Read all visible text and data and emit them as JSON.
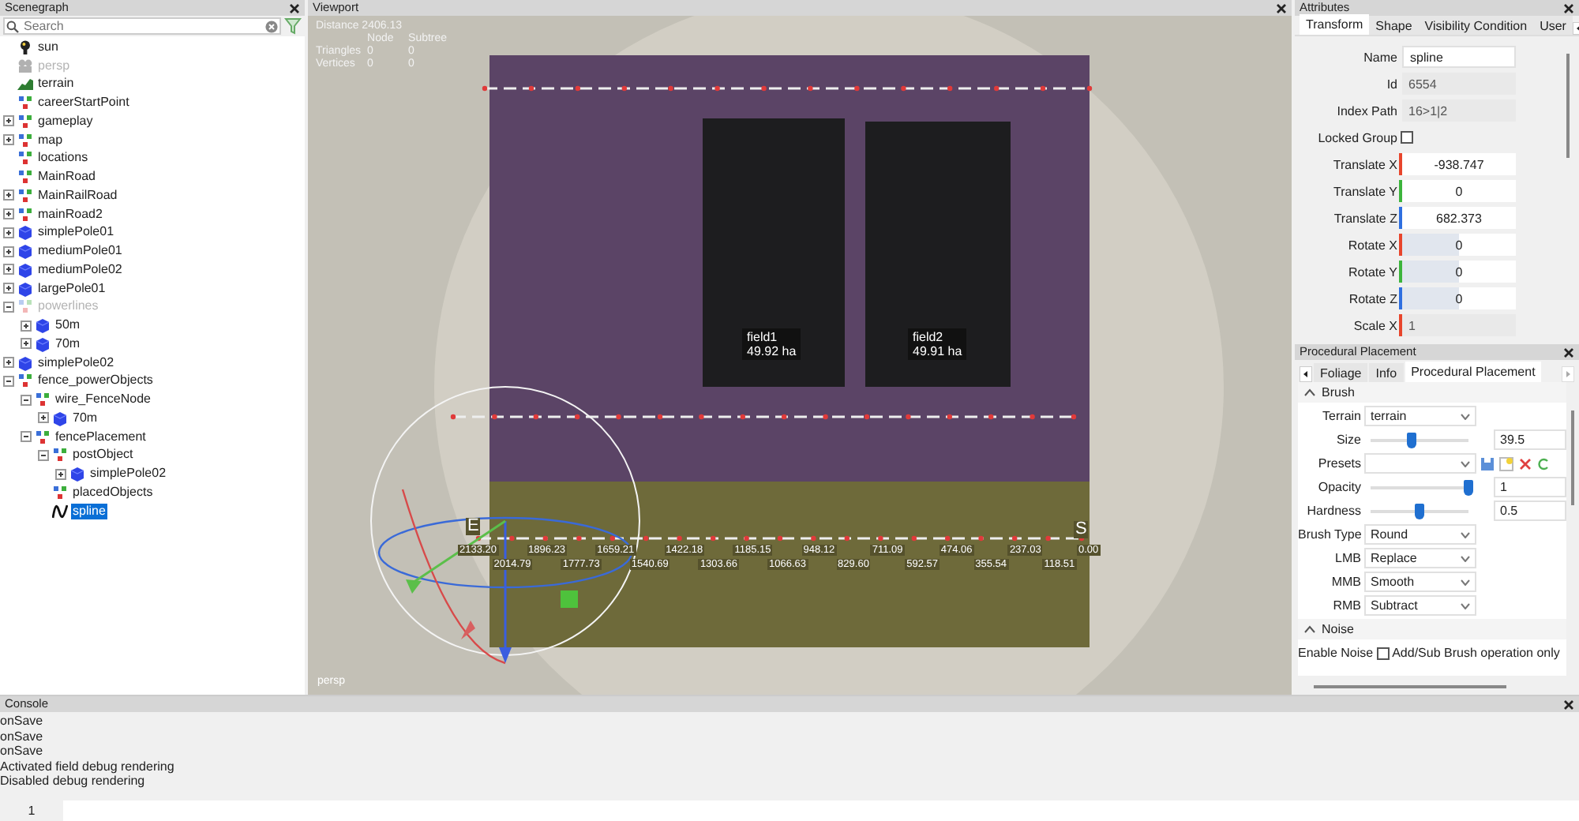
{
  "scenegraph": {
    "title": "Scenegraph",
    "search": {
      "placeholder": "Search"
    },
    "tree": [
      {
        "label": "sun",
        "kind": "light",
        "selected": false,
        "disabled": false
      },
      {
        "label": "persp",
        "kind": "camera",
        "selected": false,
        "disabled": true
      },
      {
        "label": "terrain",
        "kind": "terrain",
        "selected": false,
        "disabled": false
      },
      {
        "label": "careerStartPoint",
        "kind": "group",
        "selected": false,
        "disabled": false
      },
      {
        "label": "gameplay",
        "kind": "group",
        "expanded": false,
        "selected": false,
        "disabled": false
      },
      {
        "label": "map",
        "kind": "group",
        "expanded": false,
        "selected": false,
        "disabled": false
      },
      {
        "label": "locations",
        "kind": "group",
        "selected": false,
        "disabled": false
      },
      {
        "label": "MainRoad",
        "kind": "group",
        "selected": false,
        "disabled": false
      },
      {
        "label": "MainRailRoad",
        "kind": "group",
        "expanded": false,
        "selected": false,
        "disabled": false
      },
      {
        "label": "mainRoad2",
        "kind": "group",
        "expanded": false,
        "selected": false,
        "disabled": false
      },
      {
        "label": "simplePole01",
        "kind": "mesh",
        "expanded": false,
        "selected": false,
        "disabled": false
      },
      {
        "label": "mediumPole01",
        "kind": "mesh",
        "expanded": false,
        "selected": false,
        "disabled": false
      },
      {
        "label": "mediumPole02",
        "kind": "mesh",
        "expanded": false,
        "selected": false,
        "disabled": false
      },
      {
        "label": "largePole01",
        "kind": "mesh",
        "expanded": false,
        "selected": false,
        "disabled": false
      },
      {
        "label": "powerlines",
        "kind": "group",
        "expanded": true,
        "selected": false,
        "disabled": true,
        "children": [
          {
            "label": "50m",
            "kind": "mesh",
            "expanded": false,
            "selected": false,
            "disabled": false
          },
          {
            "label": "70m",
            "kind": "mesh",
            "expanded": false,
            "selected": false,
            "disabled": false
          }
        ]
      },
      {
        "label": "simplePole02",
        "kind": "mesh",
        "expanded": false,
        "selected": false,
        "disabled": false
      },
      {
        "label": "fence_powerObjects",
        "kind": "group",
        "expanded": true,
        "selected": false,
        "disabled": false,
        "children": [
          {
            "label": "wire_FenceNode",
            "kind": "group",
            "expanded": true,
            "selected": false,
            "disabled": false,
            "children": [
              {
                "label": "70m",
                "kind": "mesh",
                "expanded": false,
                "selected": false,
                "disabled": false
              }
            ]
          },
          {
            "label": "fencePlacement",
            "kind": "group",
            "expanded": true,
            "selected": false,
            "disabled": false,
            "children": [
              {
                "label": "postObject",
                "kind": "group",
                "expanded": true,
                "selected": false,
                "disabled": false,
                "children": [
                  {
                    "label": "simplePole02",
                    "kind": "mesh",
                    "expanded": false,
                    "selected": false,
                    "disabled": false
                  }
                ]
              },
              {
                "label": "placedObjects",
                "kind": "group",
                "selected": false,
                "disabled": false
              },
              {
                "label": "spline",
                "kind": "spline",
                "selected": true,
                "disabled": false
              }
            ]
          }
        ]
      }
    ]
  },
  "viewport": {
    "title": "Viewport",
    "distance": "Distance 2406.13",
    "stats_columns": [
      "Node",
      "Subtree"
    ],
    "stats_rows": [
      {
        "label": "Triangles",
        "node": "0",
        "subtree": "0"
      },
      {
        "label": "Vertices",
        "node": "0",
        "subtree": "0"
      }
    ],
    "fields": [
      {
        "name": "field1",
        "area": "49.92 ha"
      },
      {
        "name": "field2",
        "area": "49.91 ha"
      }
    ],
    "spline_start": "E",
    "spline_end": "S",
    "spline_distances": [
      "2133.20",
      "2014.79",
      "1896.23",
      "1777.73",
      "1659.21",
      "1540.69",
      "1422.18",
      "1303.66",
      "1185.15",
      "1066.63",
      "948.12",
      "829.60",
      "711.09",
      "592.57",
      "474.06",
      "355.54",
      "237.03",
      "118.51",
      "0.00"
    ],
    "camera": "persp"
  },
  "attributes": {
    "title": "Attributes",
    "tabs": [
      {
        "label": "Transform",
        "selected": true
      },
      {
        "label": "Shape",
        "selected": false
      },
      {
        "label": "Visibility Condition",
        "selected": false
      },
      {
        "label": "User",
        "selected": false
      }
    ],
    "rows": [
      {
        "kind": "text",
        "label": "Name",
        "value": "spline"
      },
      {
        "kind": "readonly",
        "label": "Id",
        "value": "6554"
      },
      {
        "kind": "readonly",
        "label": "Index Path",
        "value": "16>1|2"
      },
      {
        "kind": "checkbox",
        "label": "Locked Group",
        "checked": false
      },
      {
        "kind": "number",
        "label": "Translate X",
        "value": "-938.747",
        "color": "#e8452c"
      },
      {
        "kind": "number",
        "label": "Translate Y",
        "value": "0",
        "color": "#3cb43c"
      },
      {
        "kind": "number",
        "label": "Translate Z",
        "value": "682.373",
        "color": "#2f6fe0"
      },
      {
        "kind": "spin",
        "label": "Rotate X",
        "value": "0",
        "color": "#e8452c"
      },
      {
        "kind": "spin",
        "label": "Rotate Y",
        "value": "0",
        "color": "#3cb43c"
      },
      {
        "kind": "spin",
        "label": "Rotate Z",
        "value": "0",
        "color": "#2f6fe0"
      },
      {
        "kind": "readonly",
        "label": "Scale X",
        "value": "1",
        "color": "#e8452c"
      }
    ]
  },
  "procedural": {
    "title": "Procedural Placement",
    "tabs": [
      {
        "label": "Foliage",
        "selected": false
      },
      {
        "label": "Info",
        "selected": false
      },
      {
        "label": "Procedural Placement",
        "selected": true
      }
    ],
    "sections": [
      {
        "title": "Brush",
        "expanded": true,
        "rows": [
          {
            "kind": "dropdown",
            "label": "Terrain",
            "value": "terrain"
          },
          {
            "kind": "slider",
            "label": "Size",
            "level": 0.42,
            "value": "39.5"
          },
          {
            "kind": "presets",
            "label": "Presets"
          },
          {
            "kind": "slider",
            "label": "Opacity",
            "level": 1,
            "value": "1"
          },
          {
            "kind": "slider",
            "label": "Hardness",
            "level": 0.5,
            "value": "0.5"
          },
          {
            "kind": "dropdown",
            "label": "Brush Type",
            "value": "Round"
          },
          {
            "kind": "dropdown",
            "label": "LMB",
            "value": "Replace"
          },
          {
            "kind": "dropdown",
            "label": "MMB",
            "value": "Smooth"
          },
          {
            "kind": "dropdown",
            "label": "RMB",
            "value": "Subtract"
          }
        ]
      },
      {
        "title": "Noise",
        "expanded": true,
        "rows": [
          {
            "kind": "checkbox",
            "label": "Enable Noise",
            "checked": false,
            "note": "Add/Sub Brush operation only"
          }
        ]
      }
    ]
  },
  "console": {
    "title": "Console",
    "lines": [
      "onSave",
      "onSave",
      "onSave",
      "Activated field debug rendering",
      "Disabled debug rendering"
    ],
    "input": {
      "line_number": "1"
    }
  }
}
